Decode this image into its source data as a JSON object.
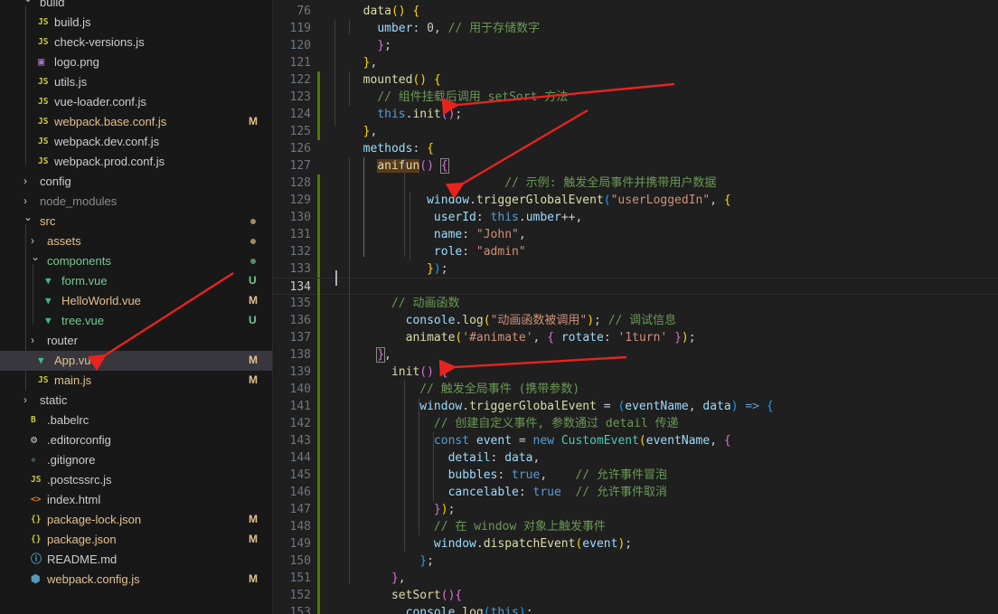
{
  "explorer": {
    "items": [
      {
        "label": "build",
        "kind": "folder-open",
        "color": "#cccccc"
      },
      {
        "label": "build.js",
        "kind": "js",
        "color": "#cccccc"
      },
      {
        "label": "check-versions.js",
        "kind": "js",
        "color": "#cccccc"
      },
      {
        "label": "logo.png",
        "kind": "image",
        "color": "#cccccc"
      },
      {
        "label": "utils.js",
        "kind": "js",
        "color": "#cccccc"
      },
      {
        "label": "vue-loader.conf.js",
        "kind": "js",
        "color": "#cccccc"
      },
      {
        "label": "webpack.base.conf.js",
        "kind": "js",
        "color": "#e2c08d",
        "badge": "M"
      },
      {
        "label": "webpack.dev.conf.js",
        "kind": "js",
        "color": "#cccccc"
      },
      {
        "label": "webpack.prod.conf.js",
        "kind": "js",
        "color": "#cccccc"
      },
      {
        "label": "config",
        "kind": "folder-closed",
        "color": "#cccccc"
      },
      {
        "label": "node_modules",
        "kind": "folder-closed",
        "color": "#8c8c8c"
      },
      {
        "label": "src",
        "kind": "folder-open",
        "color": "#e2c08d",
        "dot": "#a48a5e"
      },
      {
        "label": "assets",
        "kind": "folder-closed",
        "color": "#e2c08d",
        "dot": "#a48a5e"
      },
      {
        "label": "components",
        "kind": "folder-open",
        "color": "#73c991",
        "dot": "#4f8f64"
      },
      {
        "label": "form.vue",
        "kind": "vue",
        "color": "#73c991",
        "badge": "U"
      },
      {
        "label": "HelloWorld.vue",
        "kind": "vue",
        "color": "#e2c08d",
        "badge": "M"
      },
      {
        "label": "tree.vue",
        "kind": "vue",
        "color": "#73c991",
        "badge": "U"
      },
      {
        "label": "router",
        "kind": "folder-closed",
        "color": "#cccccc"
      },
      {
        "label": "App.vue",
        "kind": "vue",
        "color": "#e2c08d",
        "badge": "M",
        "selected": true
      },
      {
        "label": "main.js",
        "kind": "js",
        "color": "#e2c08d",
        "badge": "M"
      },
      {
        "label": "static",
        "kind": "folder-closed",
        "color": "#cccccc"
      },
      {
        "label": ".babelrc",
        "kind": "babel",
        "color": "#cccccc"
      },
      {
        "label": ".editorconfig",
        "kind": "gear",
        "color": "#cccccc"
      },
      {
        "label": ".gitignore",
        "kind": "git",
        "color": "#cccccc"
      },
      {
        "label": ".postcssrc.js",
        "kind": "js",
        "color": "#cccccc"
      },
      {
        "label": "index.html",
        "kind": "html",
        "color": "#cccccc"
      },
      {
        "label": "package-lock.json",
        "kind": "json",
        "color": "#e2c08d",
        "badge": "M"
      },
      {
        "label": "package.json",
        "kind": "json",
        "color": "#e2c08d",
        "badge": "M"
      },
      {
        "label": "README.md",
        "kind": "info",
        "color": "#cccccc"
      },
      {
        "label": "webpack.config.js",
        "kind": "webpack",
        "color": "#e2c08d",
        "badge": "M"
      }
    ],
    "icons": {
      "js": {
        "glyph": "JS",
        "color": "#cbcb41"
      },
      "vue": {
        "glyph": "▼",
        "color": "#41b883"
      },
      "image": {
        "glyph": "▣",
        "color": "#a074c4"
      },
      "json": {
        "glyph": "{}",
        "color": "#cbcb41"
      },
      "html": {
        "glyph": "<>",
        "color": "#e37933"
      },
      "babel": {
        "glyph": "B",
        "color": "#cbcb41"
      },
      "gear": {
        "glyph": "⚙",
        "color": "#cccccc"
      },
      "git": {
        "glyph": "◆",
        "color": "#41535b"
      },
      "info": {
        "glyph": "ⓘ",
        "color": "#519aba"
      },
      "webpack": {
        "glyph": "⬢",
        "color": "#519aba"
      }
    },
    "badge_colors": {
      "M": "#e2c08d",
      "U": "#73c991"
    }
  },
  "editor": {
    "lines": [
      {
        "n": "76",
        "indent": 1,
        "tokens": [
          [
            "fn",
            "data"
          ],
          [
            "p1",
            "()"
          ],
          [
            "pl",
            " "
          ],
          [
            "p1",
            "{"
          ]
        ]
      },
      {
        "n": "119",
        "indent": 2,
        "tokens": [
          [
            "prop",
            "umber"
          ],
          [
            "pl",
            ": 0, "
          ],
          [
            "cm",
            "// 用于存储数字"
          ]
        ]
      },
      {
        "n": "120",
        "indent": 2,
        "tokens": [
          [
            "p2",
            "}"
          ],
          [
            "pl",
            ";"
          ]
        ]
      },
      {
        "n": "121",
        "indent": 1,
        "tokens": [
          [
            "p1",
            "}"
          ],
          [
            "pl",
            ","
          ]
        ]
      },
      {
        "n": "122",
        "indent": 1,
        "mark": "#487e02",
        "tokens": [
          [
            "fn",
            "mounted"
          ],
          [
            "p1",
            "()"
          ],
          [
            "pl",
            " "
          ],
          [
            "p1",
            "{"
          ]
        ]
      },
      {
        "n": "123",
        "indent": 2,
        "mark": "#487e02",
        "tokens": [
          [
            "cm",
            "// 组件挂载后调用 setSort 方法"
          ]
        ]
      },
      {
        "n": "124",
        "indent": 2,
        "mark": "#487e02",
        "tokens": [
          [
            "kw",
            "this"
          ],
          [
            "pl",
            "."
          ],
          [
            "fn",
            "init"
          ],
          [
            "p2",
            "()"
          ],
          [
            "pl",
            ";"
          ]
        ]
      },
      {
        "n": "125",
        "indent": 1,
        "mark": "#487e02",
        "tokens": [
          [
            "p1",
            "}"
          ],
          [
            "pl",
            ","
          ]
        ]
      },
      {
        "n": "126",
        "indent": 1,
        "tokens": [
          [
            "prop",
            "methods"
          ],
          [
            "pl",
            ": "
          ],
          [
            "p1",
            "{"
          ]
        ]
      },
      {
        "n": "127",
        "indent": 2,
        "tokens": [
          [
            "fnhl",
            "anifun"
          ],
          [
            "p2",
            "()"
          ],
          [
            "pl",
            " "
          ],
          [
            "p2box",
            "{"
          ]
        ]
      },
      {
        "n": "128",
        "indent": 2,
        "mark": "#487e02",
        "extra": "                  ",
        "tokens": [
          [
            "cm",
            "// 示例: 触发全局事件并携带用户数据"
          ]
        ]
      },
      {
        "n": "129",
        "indent": 2,
        "mark": "#487e02",
        "extra": "       ",
        "tokens": [
          [
            "prop",
            "window"
          ],
          [
            "pl",
            "."
          ],
          [
            "fn",
            "triggerGlobalEvent"
          ],
          [
            "p3",
            "("
          ],
          [
            "str",
            "\"userLoggedIn\""
          ],
          [
            "pl",
            ", "
          ],
          [
            "p1",
            "{"
          ]
        ]
      },
      {
        "n": "130",
        "indent": 2,
        "mark": "#487e02",
        "extra": "        ",
        "tokens": [
          [
            "prop",
            "userId"
          ],
          [
            "pl",
            ": "
          ],
          [
            "kw",
            "this"
          ],
          [
            "pl",
            "."
          ],
          [
            "prop",
            "umber"
          ],
          [
            "pl",
            "++,"
          ]
        ]
      },
      {
        "n": "131",
        "indent": 2,
        "mark": "#487e02",
        "extra": "        ",
        "tokens": [
          [
            "prop",
            "name"
          ],
          [
            "pl",
            ": "
          ],
          [
            "str",
            "\"John\""
          ],
          [
            "pl",
            ","
          ]
        ]
      },
      {
        "n": "132",
        "indent": 2,
        "mark": "#487e02",
        "extra": "        ",
        "tokens": [
          [
            "prop",
            "role"
          ],
          [
            "pl",
            ": "
          ],
          [
            "str",
            "\"admin\""
          ]
        ]
      },
      {
        "n": "133",
        "indent": 2,
        "mark": "#487e02",
        "extra": "       ",
        "tokens": [
          [
            "p1",
            "}"
          ],
          [
            "p3",
            ")"
          ],
          [
            "pl",
            ";"
          ]
        ]
      },
      {
        "n": "134",
        "indent": 0,
        "mark": "#487e02",
        "current": true,
        "tokens": []
      },
      {
        "n": "135",
        "indent": 2,
        "mark": "#487e02",
        "extra": "  ",
        "tokens": [
          [
            "cm",
            "// 动画函数"
          ]
        ]
      },
      {
        "n": "136",
        "indent": 2,
        "mark": "#487e02",
        "extra": "    ",
        "tokens": [
          [
            "prop",
            "console"
          ],
          [
            "pl",
            "."
          ],
          [
            "fn",
            "log"
          ],
          [
            "p1",
            "("
          ],
          [
            "str",
            "\"动画函数被调用\""
          ],
          [
            "p1",
            ")"
          ],
          [
            "pl",
            "; "
          ],
          [
            "cm",
            "// 调试信息"
          ]
        ]
      },
      {
        "n": "137",
        "indent": 2,
        "mark": "#487e02",
        "extra": "    ",
        "tokens": [
          [
            "fn",
            "animate"
          ],
          [
            "p1",
            "("
          ],
          [
            "str",
            "'#animate'"
          ],
          [
            "pl",
            ", "
          ],
          [
            "p2",
            "{"
          ],
          [
            "pl",
            " "
          ],
          [
            "prop",
            "rotate"
          ],
          [
            "pl",
            ": "
          ],
          [
            "str",
            "'1turn'"
          ],
          [
            "pl",
            " "
          ],
          [
            "p2",
            "}"
          ],
          [
            "p1",
            ")"
          ],
          [
            "pl",
            ";"
          ]
        ]
      },
      {
        "n": "138",
        "indent": 2,
        "mark": "#487e02",
        "tokens": [
          [
            "p2box",
            "}"
          ],
          [
            "pl",
            ","
          ]
        ]
      },
      {
        "n": "139",
        "indent": 2,
        "mark": "#487e02",
        "extra": "  ",
        "tokens": [
          [
            "fn",
            "init"
          ],
          [
            "p2",
            "()"
          ],
          [
            "pl",
            " "
          ],
          [
            "p2",
            "{"
          ]
        ]
      },
      {
        "n": "140",
        "indent": 2,
        "mark": "#487e02",
        "extra": "      ",
        "tokens": [
          [
            "cm",
            "// 触发全局事件 (携带参数) "
          ]
        ]
      },
      {
        "n": "141",
        "indent": 2,
        "mark": "#487e02",
        "extra": "      ",
        "tokens": [
          [
            "prop",
            "window"
          ],
          [
            "pl",
            "."
          ],
          [
            "fn",
            "triggerGlobalEvent"
          ],
          [
            "pl",
            " = "
          ],
          [
            "p3",
            "("
          ],
          [
            "prop",
            "eventName"
          ],
          [
            "pl",
            ", "
          ],
          [
            "prop",
            "data"
          ],
          [
            "p3",
            ")"
          ],
          [
            "pl",
            " "
          ],
          [
            "kw",
            "=>"
          ],
          [
            "pl",
            " "
          ],
          [
            "p3",
            "{"
          ]
        ]
      },
      {
        "n": "142",
        "indent": 2,
        "mark": "#487e02",
        "extra": "        ",
        "tokens": [
          [
            "cm",
            "// 创建自定义事件, 参数通过 detail 传递"
          ]
        ]
      },
      {
        "n": "143",
        "indent": 2,
        "mark": "#487e02",
        "extra": "        ",
        "tokens": [
          [
            "kw",
            "const"
          ],
          [
            "pl",
            " "
          ],
          [
            "prop",
            "event"
          ],
          [
            "pl",
            " = "
          ],
          [
            "kw",
            "new"
          ],
          [
            "pl",
            " "
          ],
          [
            "cls",
            "CustomEvent"
          ],
          [
            "p1",
            "("
          ],
          [
            "prop",
            "eventName"
          ],
          [
            "pl",
            ", "
          ],
          [
            "p2",
            "{"
          ]
        ]
      },
      {
        "n": "144",
        "indent": 2,
        "mark": "#487e02",
        "extra": "          ",
        "tokens": [
          [
            "prop",
            "detail"
          ],
          [
            "pl",
            ": "
          ],
          [
            "prop",
            "data"
          ],
          [
            "pl",
            ","
          ]
        ]
      },
      {
        "n": "145",
        "indent": 2,
        "mark": "#487e02",
        "extra": "          ",
        "tokens": [
          [
            "prop",
            "bubbles"
          ],
          [
            "pl",
            ": "
          ],
          [
            "kw",
            "true"
          ],
          [
            "pl",
            ",    "
          ],
          [
            "cm",
            "// 允许事件冒泡"
          ]
        ]
      },
      {
        "n": "146",
        "indent": 2,
        "mark": "#487e02",
        "extra": "          ",
        "tokens": [
          [
            "prop",
            "cancelable"
          ],
          [
            "pl",
            ": "
          ],
          [
            "kw",
            "true"
          ],
          [
            "pl",
            "  "
          ],
          [
            "cm",
            "// 允许事件取消"
          ]
        ]
      },
      {
        "n": "147",
        "indent": 2,
        "mark": "#487e02",
        "extra": "        ",
        "tokens": [
          [
            "p2",
            "}"
          ],
          [
            "p1",
            ")"
          ],
          [
            "pl",
            ";"
          ]
        ]
      },
      {
        "n": "148",
        "indent": 2,
        "mark": "#487e02",
        "extra": "        ",
        "tokens": [
          [
            "cm",
            "// 在 window 对象上触发事件"
          ]
        ]
      },
      {
        "n": "149",
        "indent": 2,
        "mark": "#487e02",
        "extra": "        ",
        "tokens": [
          [
            "prop",
            "window"
          ],
          [
            "pl",
            "."
          ],
          [
            "fn",
            "dispatchEvent"
          ],
          [
            "p1",
            "("
          ],
          [
            "prop",
            "event"
          ],
          [
            "p1",
            ")"
          ],
          [
            "pl",
            ";"
          ]
        ]
      },
      {
        "n": "150",
        "indent": 2,
        "mark": "#487e02",
        "extra": "      ",
        "tokens": [
          [
            "p3",
            "}"
          ],
          [
            "pl",
            ";"
          ]
        ]
      },
      {
        "n": "151",
        "indent": 2,
        "mark": "#487e02",
        "extra": "  ",
        "tokens": [
          [
            "p2",
            "}"
          ],
          [
            "pl",
            ","
          ]
        ]
      },
      {
        "n": "152",
        "indent": 2,
        "mark": "#487e02",
        "extra": "  ",
        "tokens": [
          [
            "fn",
            "setSort"
          ],
          [
            "p2",
            "()"
          ],
          [
            "p2",
            "{"
          ]
        ]
      },
      {
        "n": "153",
        "indent": 2,
        "mark": "#487e02",
        "extra": "    ",
        "tokens": [
          [
            "prop",
            "console"
          ],
          [
            "pl",
            "."
          ],
          [
            "fn",
            "log"
          ],
          [
            "p3",
            "("
          ],
          [
            "kw",
            "this"
          ],
          [
            "p3",
            ")"
          ],
          [
            "pl",
            ";"
          ]
        ]
      }
    ]
  },
  "annotations": {
    "arrow_color": "#e8231e"
  }
}
